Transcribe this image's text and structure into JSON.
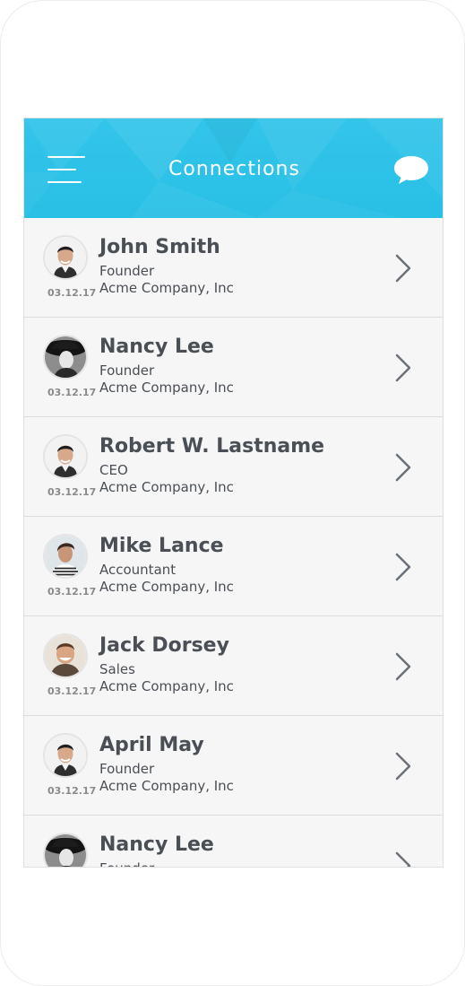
{
  "header": {
    "title": "Connections",
    "menu_icon": "hamburger-menu-icon",
    "chat_icon": "chat-bubble-icon",
    "background_color": "#2bc2e8"
  },
  "connections": [
    {
      "name": "John Smith",
      "role": "Founder",
      "company": "Acme Company, Inc",
      "date": "03.12.17",
      "avatar": "man-portrait"
    },
    {
      "name": "Nancy Lee",
      "role": "Founder",
      "company": "Acme Company, Inc",
      "date": "03.12.17",
      "avatar": "woman-hat-portrait"
    },
    {
      "name": "Robert W. Lastname",
      "role": "CEO",
      "company": "Acme Company, Inc",
      "date": "03.12.17",
      "avatar": "man-portrait"
    },
    {
      "name": "Mike Lance",
      "role": "Accountant",
      "company": "Acme Company, Inc",
      "date": "03.12.17",
      "avatar": "man-striped-portrait"
    },
    {
      "name": "Jack Dorsey",
      "role": "Sales",
      "company": "Acme Company, Inc",
      "date": "03.12.17",
      "avatar": "man-smiling-portrait"
    },
    {
      "name": "April May",
      "role": "Founder",
      "company": "Acme Company, Inc",
      "date": "03.12.17",
      "avatar": "man-portrait"
    },
    {
      "name": "Nancy Lee",
      "role": "Founder",
      "company": "",
      "date": "",
      "avatar": "woman-hat-portrait"
    }
  ],
  "colors": {
    "text": "#4a4f55",
    "date": "#8a8a8a",
    "row_bg": "#f6f6f6",
    "divider": "#dcdcdc",
    "chevron": "#6b7178"
  }
}
